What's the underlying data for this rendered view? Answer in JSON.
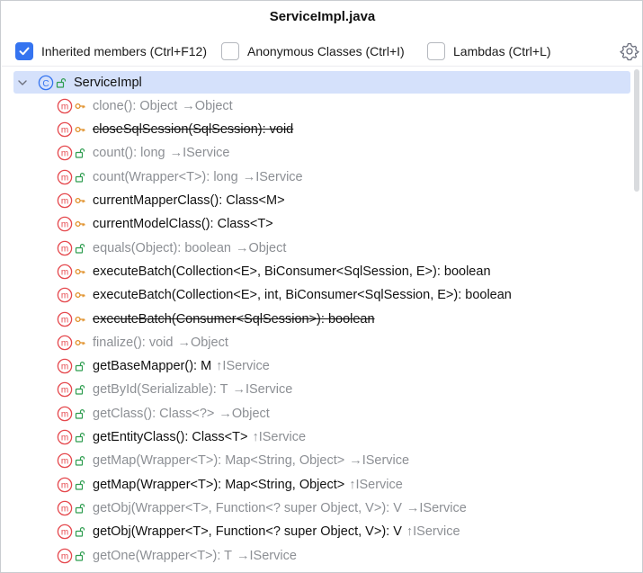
{
  "window": {
    "title": "ServiceImpl.java"
  },
  "toolbar": {
    "inherited": {
      "label": "Inherited members (Ctrl+F12)",
      "checked": true
    },
    "anonymous": {
      "label": "Anonymous Classes (Ctrl+I)",
      "checked": false
    },
    "lambdas": {
      "label": "Lambdas (Ctrl+L)",
      "checked": false
    },
    "settings_icon": "gear-icon"
  },
  "colors": {
    "accent": "#3574f0",
    "selection": "#d5e1fb",
    "method_icon": "#e5484d",
    "public_vis": "#2e9d4f",
    "protected_vis": "#e08f27",
    "muted_text": "#8c8f94"
  },
  "tree": {
    "root": {
      "label": "ServiceImpl",
      "icon": "class-icon",
      "visibility": "public"
    },
    "members": [
      {
        "sig": "clone(): Object",
        "inherit": "→Object",
        "vis": "protected",
        "style": "muted"
      },
      {
        "sig": "closeSqlSession(SqlSession): void",
        "inherit": "",
        "vis": "protected",
        "style": "strike"
      },
      {
        "sig": "count(): long",
        "inherit": "→IService",
        "vis": "public",
        "style": "muted"
      },
      {
        "sig": "count(Wrapper<T>): long",
        "inherit": "→IService",
        "vis": "public",
        "style": "muted"
      },
      {
        "sig": "currentMapperClass(): Class<M>",
        "inherit": "",
        "vis": "protected",
        "style": "normal"
      },
      {
        "sig": "currentModelClass(): Class<T>",
        "inherit": "",
        "vis": "protected",
        "style": "normal"
      },
      {
        "sig": "equals(Object): boolean",
        "inherit": "→Object",
        "vis": "public",
        "style": "muted"
      },
      {
        "sig": "executeBatch(Collection<E>, BiConsumer<SqlSession, E>): boolean",
        "inherit": "",
        "vis": "protected",
        "style": "normal"
      },
      {
        "sig": "executeBatch(Collection<E>, int, BiConsumer<SqlSession, E>): boolean",
        "inherit": "",
        "vis": "protected",
        "style": "normal"
      },
      {
        "sig": "executeBatch(Consumer<SqlSession>): boolean",
        "inherit": "",
        "vis": "protected",
        "style": "strike"
      },
      {
        "sig": "finalize(): void",
        "inherit": "→Object",
        "vis": "protected",
        "style": "muted"
      },
      {
        "sig": "getBaseMapper(): M",
        "inherit": "↑IService",
        "vis": "public",
        "style": "normal"
      },
      {
        "sig": "getById(Serializable): T",
        "inherit": "→IService",
        "vis": "public",
        "style": "muted"
      },
      {
        "sig": "getClass(): Class<?>",
        "inherit": "→Object",
        "vis": "public",
        "style": "muted"
      },
      {
        "sig": "getEntityClass(): Class<T>",
        "inherit": "↑IService",
        "vis": "public",
        "style": "normal"
      },
      {
        "sig": "getMap(Wrapper<T>): Map<String, Object>",
        "inherit": "→IService",
        "vis": "public",
        "style": "muted"
      },
      {
        "sig": "getMap(Wrapper<T>): Map<String, Object>",
        "inherit": "↑IService",
        "vis": "public",
        "style": "normal"
      },
      {
        "sig": "getObj(Wrapper<T>, Function<? super Object, V>): V",
        "inherit": "→IService",
        "vis": "public",
        "style": "muted"
      },
      {
        "sig": "getObj(Wrapper<T>, Function<? super Object, V>): V",
        "inherit": "↑IService",
        "vis": "public",
        "style": "normal"
      },
      {
        "sig": "getOne(Wrapper<T>): T",
        "inherit": "→IService",
        "vis": "public",
        "style": "muted"
      }
    ]
  }
}
